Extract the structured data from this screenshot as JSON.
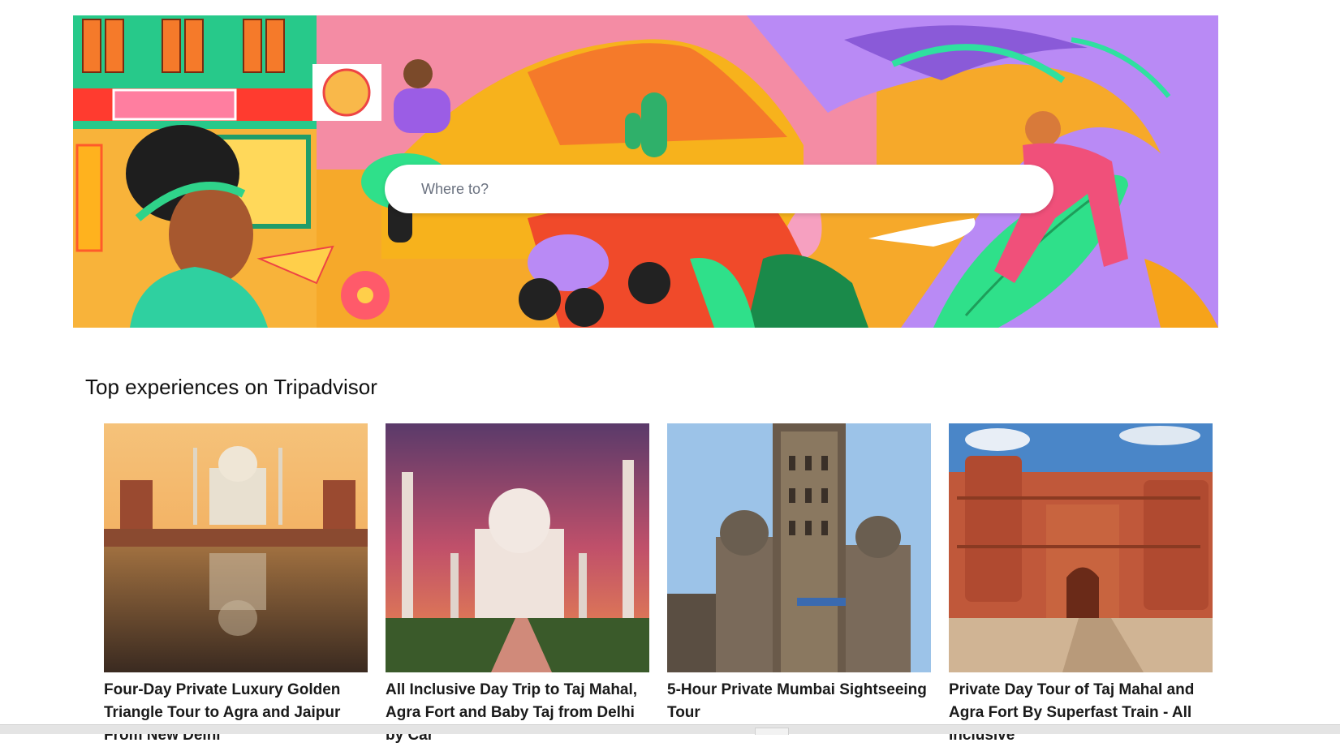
{
  "search": {
    "placeholder": "Where to?"
  },
  "section": {
    "title": "Top experiences on Tripadvisor"
  },
  "cards": [
    {
      "title": "Four-Day Private Luxury Golden Triangle Tour to Agra and Jaipur From New Delhi",
      "image": "taj-mahal-reflection-image"
    },
    {
      "title": "All Inclusive Day Trip to Taj Mahal, Agra Fort and Baby Taj from Delhi by Car",
      "image": "taj-mahal-sunset-image"
    },
    {
      "title": "5-Hour Private Mumbai Sightseeing Tour",
      "image": "mumbai-municipal-building-image"
    },
    {
      "title": "Private Day Tour of Taj Mahal and Agra Fort By Superfast Train - All Inclusive",
      "image": "agra-fort-image"
    }
  ],
  "colors": {
    "hero_pink": "#f28aa0",
    "hero_orange": "#f6a31a",
    "hero_purple": "#b48af0",
    "hero_green": "#2fd38a"
  }
}
